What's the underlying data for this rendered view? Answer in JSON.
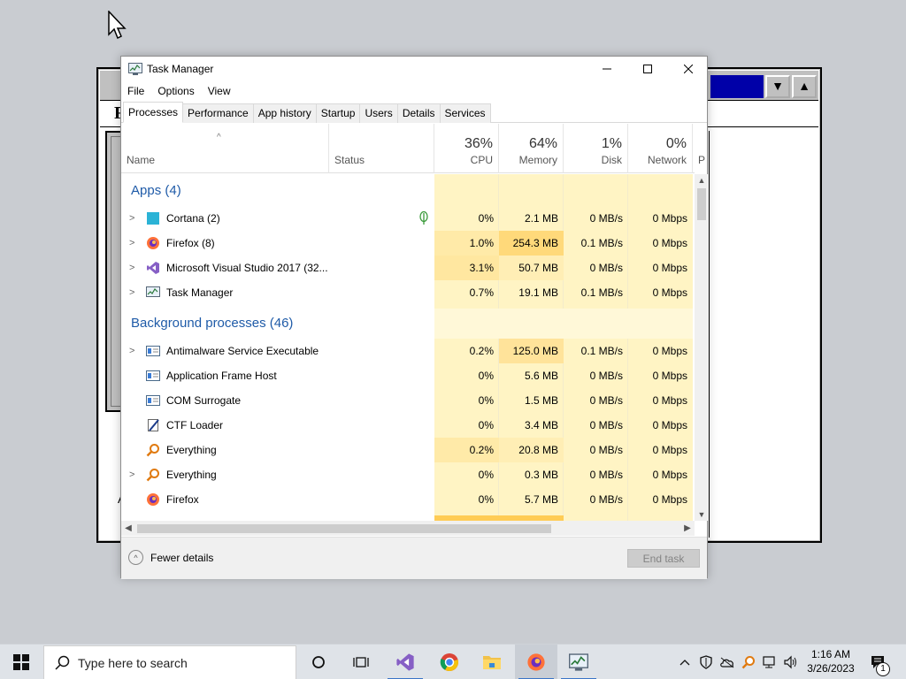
{
  "window": {
    "title": "Task Manager",
    "menu": [
      "File",
      "Options",
      "View"
    ],
    "tabs": [
      "Processes",
      "Performance",
      "App history",
      "Startup",
      "Users",
      "Details",
      "Services"
    ],
    "active_tab": "Processes"
  },
  "columns": {
    "name": "Name",
    "status": "Status",
    "cpu": {
      "label": "CPU",
      "pct": "36%"
    },
    "memory": {
      "label": "Memory",
      "pct": "64%"
    },
    "disk": {
      "label": "Disk",
      "pct": "1%"
    },
    "network": {
      "label": "Network",
      "pct": "0%"
    },
    "power_partial": "P"
  },
  "groups": {
    "apps": "Apps (4)",
    "background": "Background processes (46)"
  },
  "apps": [
    {
      "name": "Cortana (2)",
      "cpu": "0%",
      "memory": "2.1 MB",
      "disk": "0 MB/s",
      "network": "0 Mbps",
      "icon": "cortana-icon"
    },
    {
      "name": "Firefox (8)",
      "cpu": "1.0%",
      "memory": "254.3 MB",
      "disk": "0.1 MB/s",
      "network": "0 Mbps",
      "icon": "firefox-icon"
    },
    {
      "name": "Microsoft Visual Studio 2017 (32...",
      "cpu": "3.1%",
      "memory": "50.7 MB",
      "disk": "0 MB/s",
      "network": "0 Mbps",
      "icon": "visual-studio-icon"
    },
    {
      "name": "Task Manager",
      "cpu": "0.7%",
      "memory": "19.1 MB",
      "disk": "0.1 MB/s",
      "network": "0 Mbps",
      "icon": "task-manager-icon"
    }
  ],
  "background": [
    {
      "name": "Antimalware Service Executable",
      "cpu": "0.2%",
      "memory": "125.0 MB",
      "disk": "0.1 MB/s",
      "network": "0 Mbps",
      "icon": "service-icon"
    },
    {
      "name": "Application Frame Host",
      "cpu": "0%",
      "memory": "5.6 MB",
      "disk": "0 MB/s",
      "network": "0 Mbps",
      "icon": "service-icon"
    },
    {
      "name": "COM Surrogate",
      "cpu": "0%",
      "memory": "1.5 MB",
      "disk": "0 MB/s",
      "network": "0 Mbps",
      "icon": "service-icon"
    },
    {
      "name": "CTF Loader",
      "cpu": "0%",
      "memory": "3.4 MB",
      "disk": "0 MB/s",
      "network": "0 Mbps",
      "icon": "ctf-loader-icon"
    },
    {
      "name": "Everything",
      "cpu": "0.2%",
      "memory": "20.8 MB",
      "disk": "0 MB/s",
      "network": "0 Mbps",
      "icon": "everything-icon"
    },
    {
      "name": "Everything",
      "cpu": "0%",
      "memory": "0.3 MB",
      "disk": "0 MB/s",
      "network": "0 Mbps",
      "icon": "everything-icon"
    },
    {
      "name": "Firefox",
      "cpu": "0%",
      "memory": "5.7 MB",
      "disk": "0 MB/s",
      "network": "0 Mbps",
      "icon": "firefox-icon"
    }
  ],
  "footer": {
    "fewer_details": "Fewer details",
    "end_task": "End task"
  },
  "taskbar": {
    "search_placeholder": "Type here to search",
    "time": "1:16 AM",
    "date": "3/26/2023"
  },
  "colors": {
    "heat_light": "#fff4c4",
    "heat_mid": "#ffe9a0",
    "heat_strong": "#ffd97a",
    "group_text": "#1f5ba8",
    "accent": "#3a74c7"
  }
}
